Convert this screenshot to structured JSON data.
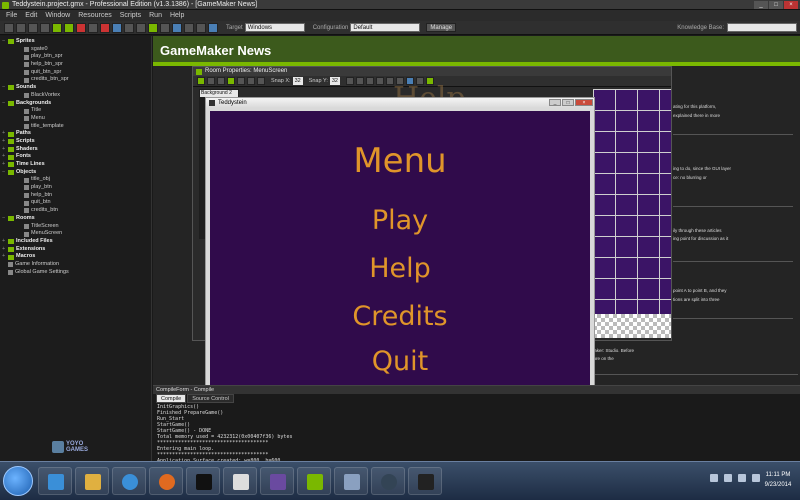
{
  "window": {
    "title": "Teddystein.project.gmx - Professional Edition (v1.3.1386) - [GameMaker News]"
  },
  "menu": [
    "File",
    "Edit",
    "Window",
    "Resources",
    "Scripts",
    "Run",
    "Help"
  ],
  "toolbar": {
    "target_label": "Target",
    "target_value": "Windows",
    "config_label": "Configuration",
    "config_value": "Default",
    "manage_label": "Manage",
    "kb_label": "Knowledge Base:"
  },
  "tree": {
    "sections": [
      {
        "name": "Sprites",
        "items": [
          "sgate0",
          "play_btn_spr",
          "help_btn_spr",
          "quit_btn_spr",
          "credits_btn_spr"
        ]
      },
      {
        "name": "Sounds",
        "items": [
          "BlackVortex"
        ]
      },
      {
        "name": "Backgrounds",
        "items": [
          "Title",
          "Menu",
          "title_template"
        ]
      },
      {
        "name": "Paths",
        "items": []
      },
      {
        "name": "Scripts",
        "items": []
      },
      {
        "name": "Shaders",
        "items": []
      },
      {
        "name": "Fonts",
        "items": []
      },
      {
        "name": "Time Lines",
        "items": []
      },
      {
        "name": "Objects",
        "items": [
          "title_obj",
          "play_btn",
          "help_btn",
          "quit_btn",
          "credits_btn"
        ]
      },
      {
        "name": "Rooms",
        "items": [
          "TitleScreen",
          "MenuScreen"
        ]
      },
      {
        "name": "Included Files",
        "items": []
      },
      {
        "name": "Extensions",
        "items": []
      },
      {
        "name": "Macros",
        "items": []
      }
    ],
    "footer_items": [
      "Game Information",
      "Global Game Settings"
    ]
  },
  "yoyo": {
    "line1": "YOYO",
    "line2": "GAMES"
  },
  "news": {
    "title": "GameMaker News",
    "snippets": [
      "ating for this platform,",
      "explained there in more",
      "ing to do, since the GUI layer",
      "ce: no blurring or",
      "ily through these articles",
      "ing point for discussion as it",
      "point A to point B, and they",
      "tions are split into three"
    ],
    "bottom_line1": "ut about the inner workings of GameMaker: Studio. Before",
    "bottom_line2": "hings mentioned here are generally more on the"
  },
  "room": {
    "title": "Room Properties: MenuScreen",
    "snap_x_label": "Snap X:",
    "snap_x": "32",
    "snap_y_label": "Snap Y:",
    "snap_y": "32",
    "bg_label": "Background 2",
    "ghost_text": "Help"
  },
  "game": {
    "title": "Teddystein",
    "menu_title": "Menu",
    "play": "Play",
    "help": "Help",
    "credits": "Credits",
    "quit": "Quit"
  },
  "compile": {
    "title": "CompileForm - Compile",
    "tabs": [
      "Compile",
      "Source Control"
    ],
    "log": [
      "InitGraphics()",
      "Finished PrepareGame()",
      "Run_Start",
      "StartGame()",
      "StartGame() - DONE",
      "Total memory used = 4232312(0x00407f36) bytes",
      "*************************************",
      "Entering main loop.",
      "*************************************",
      "Application Surface created: w=800, h=600"
    ]
  },
  "taskbar": {
    "time": "11:11 PM",
    "date": "9/23/2014"
  },
  "colors": {
    "accent": "#7ab800",
    "game_bg": "#300b4b",
    "game_text": "#e0952a"
  }
}
